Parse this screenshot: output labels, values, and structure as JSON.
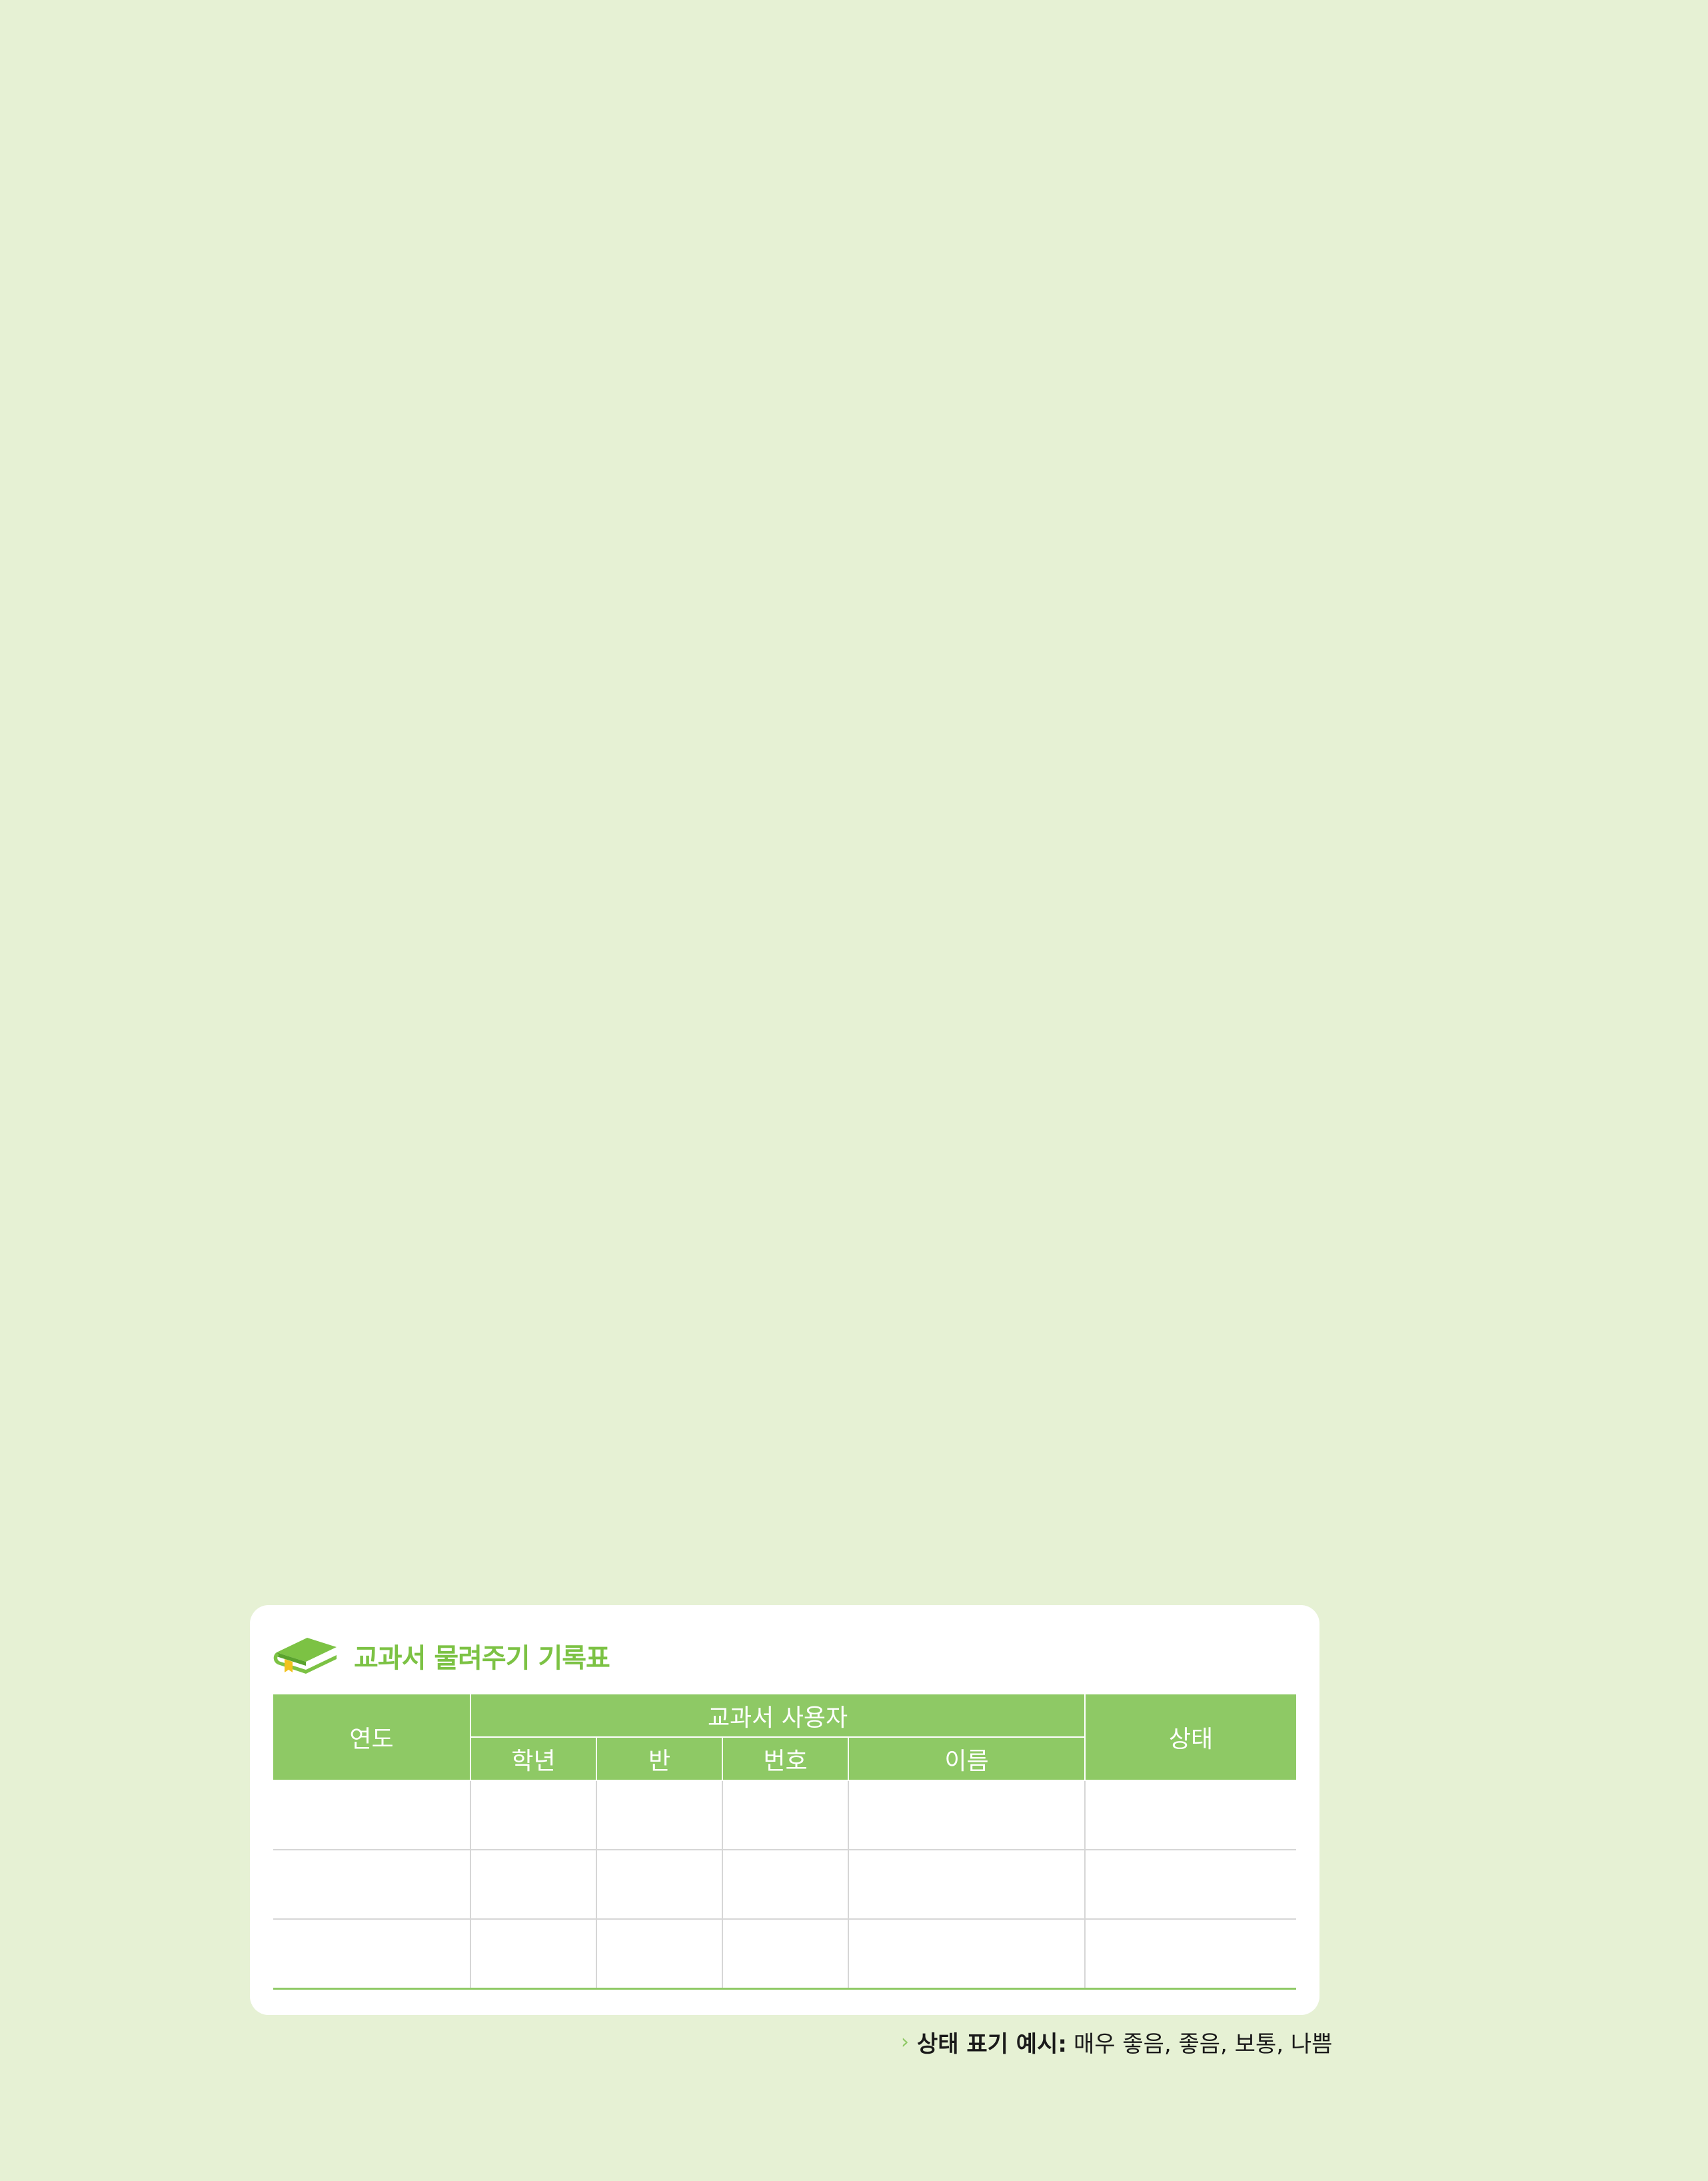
{
  "record_card": {
    "title": "교과서 물려주기 기록표",
    "icon": "book-icon",
    "colors": {
      "accent": "#7cc244",
      "header_bg": "#8ec965",
      "page_bg": "#e6f1d4",
      "bookmark": "#f2c21b"
    },
    "table": {
      "year_header": "연도",
      "user_group_header": "교과서 사용자",
      "user_sub_headers": [
        "학년",
        "반",
        "번호",
        "이름"
      ],
      "status_header": "상태",
      "blank_rows": 3
    }
  },
  "note": {
    "chevron": "›",
    "label": "상태 표기 예시:",
    "text": "매우 좋음, 좋음, 보통, 나쁨"
  }
}
